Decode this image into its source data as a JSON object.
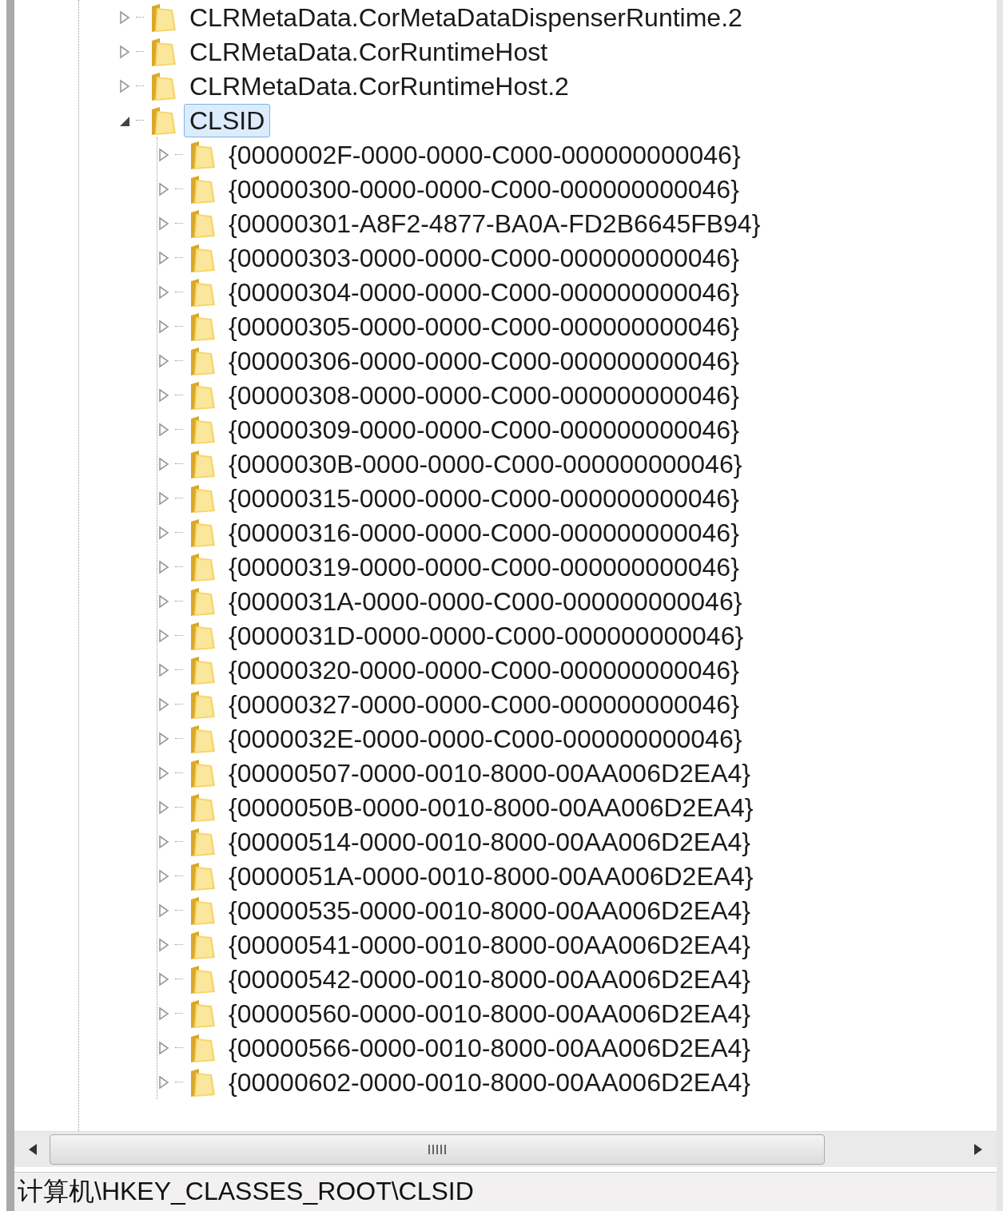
{
  "tree": {
    "items": [
      {
        "label": "CLRMetaData.CorMetaDataDispenserRuntime.2",
        "expanded": false,
        "selected": false
      },
      {
        "label": "CLRMetaData.CorRuntimeHost",
        "expanded": false,
        "selected": false
      },
      {
        "label": "CLRMetaData.CorRuntimeHost.2",
        "expanded": false,
        "selected": false
      },
      {
        "label": "CLSID",
        "expanded": true,
        "selected": true,
        "children": [
          {
            "label": "{0000002F-0000-0000-C000-000000000046}",
            "expanded": false,
            "selected": false
          },
          {
            "label": "{00000300-0000-0000-C000-000000000046}",
            "expanded": false,
            "selected": false
          },
          {
            "label": "{00000301-A8F2-4877-BA0A-FD2B6645FB94}",
            "expanded": false,
            "selected": false
          },
          {
            "label": "{00000303-0000-0000-C000-000000000046}",
            "expanded": false,
            "selected": false
          },
          {
            "label": "{00000304-0000-0000-C000-000000000046}",
            "expanded": false,
            "selected": false
          },
          {
            "label": "{00000305-0000-0000-C000-000000000046}",
            "expanded": false,
            "selected": false
          },
          {
            "label": "{00000306-0000-0000-C000-000000000046}",
            "expanded": false,
            "selected": false
          },
          {
            "label": "{00000308-0000-0000-C000-000000000046}",
            "expanded": false,
            "selected": false
          },
          {
            "label": "{00000309-0000-0000-C000-000000000046}",
            "expanded": false,
            "selected": false
          },
          {
            "label": "{0000030B-0000-0000-C000-000000000046}",
            "expanded": false,
            "selected": false
          },
          {
            "label": "{00000315-0000-0000-C000-000000000046}",
            "expanded": false,
            "selected": false
          },
          {
            "label": "{00000316-0000-0000-C000-000000000046}",
            "expanded": false,
            "selected": false
          },
          {
            "label": "{00000319-0000-0000-C000-000000000046}",
            "expanded": false,
            "selected": false
          },
          {
            "label": "{0000031A-0000-0000-C000-000000000046}",
            "expanded": false,
            "selected": false
          },
          {
            "label": "{0000031D-0000-0000-C000-000000000046}",
            "expanded": false,
            "selected": false
          },
          {
            "label": "{00000320-0000-0000-C000-000000000046}",
            "expanded": false,
            "selected": false
          },
          {
            "label": "{00000327-0000-0000-C000-000000000046}",
            "expanded": false,
            "selected": false
          },
          {
            "label": "{0000032E-0000-0000-C000-000000000046}",
            "expanded": false,
            "selected": false
          },
          {
            "label": "{00000507-0000-0010-8000-00AA006D2EA4}",
            "expanded": false,
            "selected": false
          },
          {
            "label": "{0000050B-0000-0010-8000-00AA006D2EA4}",
            "expanded": false,
            "selected": false
          },
          {
            "label": "{00000514-0000-0010-8000-00AA006D2EA4}",
            "expanded": false,
            "selected": false
          },
          {
            "label": "{0000051A-0000-0010-8000-00AA006D2EA4}",
            "expanded": false,
            "selected": false
          },
          {
            "label": "{00000535-0000-0010-8000-00AA006D2EA4}",
            "expanded": false,
            "selected": false
          },
          {
            "label": "{00000541-0000-0010-8000-00AA006D2EA4}",
            "expanded": false,
            "selected": false
          },
          {
            "label": "{00000542-0000-0010-8000-00AA006D2EA4}",
            "expanded": false,
            "selected": false
          },
          {
            "label": "{00000560-0000-0010-8000-00AA006D2EA4}",
            "expanded": false,
            "selected": false
          },
          {
            "label": "{00000566-0000-0010-8000-00AA006D2EA4}",
            "expanded": false,
            "selected": false
          },
          {
            "label": "{00000602-0000-0010-8000-00AA006D2EA4}",
            "expanded": false,
            "selected": false
          }
        ]
      }
    ]
  },
  "status_bar": {
    "path": "计算机\\HKEY_CLASSES_ROOT\\CLSID"
  }
}
